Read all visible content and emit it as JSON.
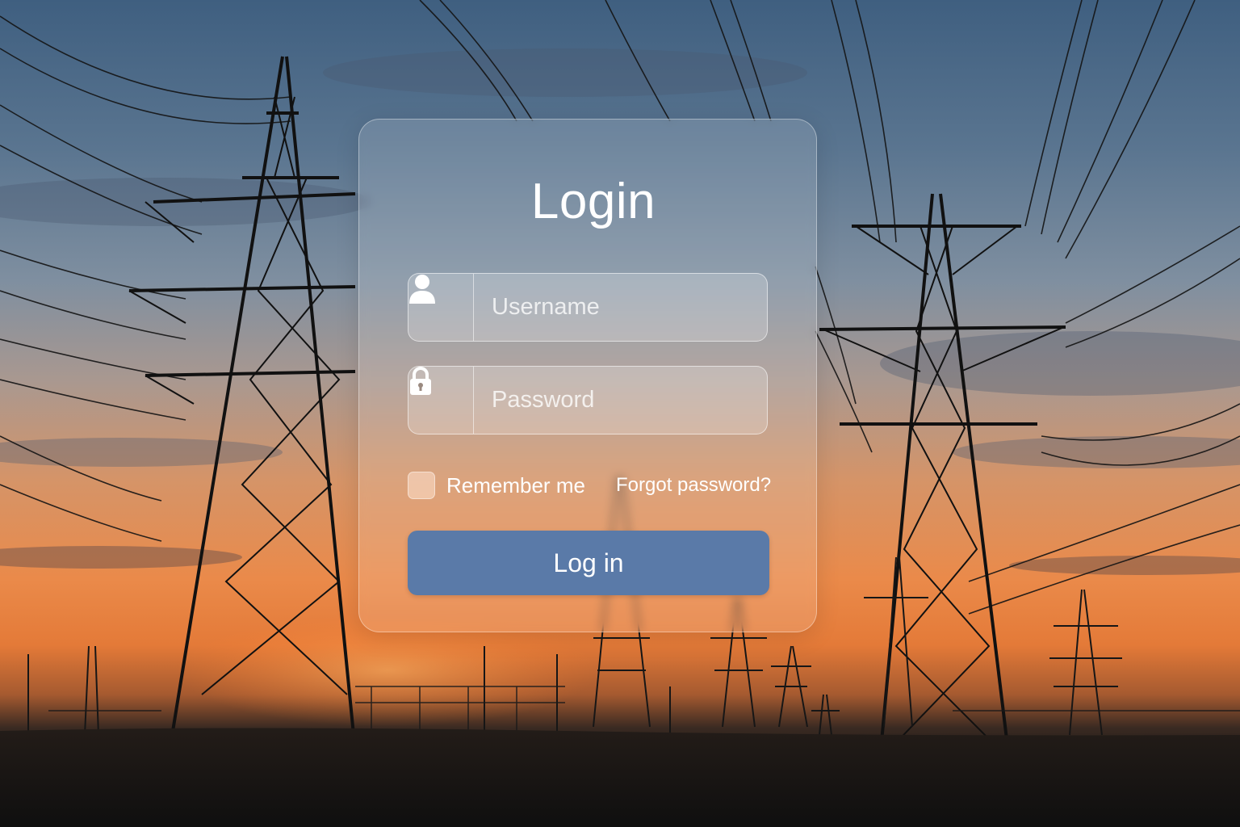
{
  "login": {
    "title": "Login",
    "username": {
      "placeholder": "Username",
      "icon": "user-icon"
    },
    "password": {
      "placeholder": "Password",
      "icon": "lock-icon"
    },
    "remember_label": "Remember me",
    "remember_checked": false,
    "forgot_label": "Forgot password?",
    "submit_label": "Log in"
  },
  "colors": {
    "button": "#5a7aa8",
    "text": "#ffffff"
  }
}
